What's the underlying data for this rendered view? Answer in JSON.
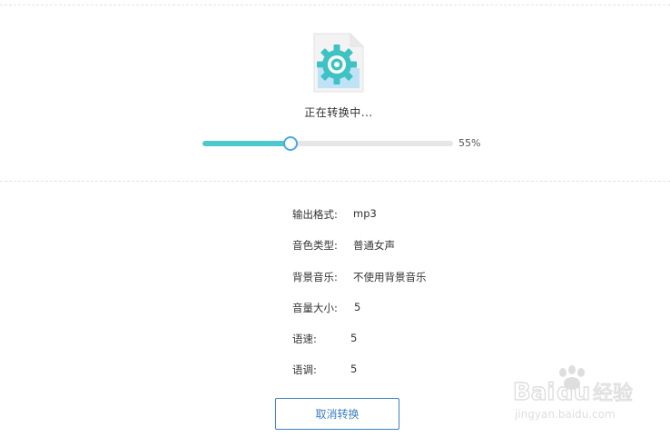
{
  "status": {
    "text": "正在转换中..."
  },
  "progress": {
    "value": 0.55,
    "label": "55%"
  },
  "details": [
    {
      "label": "输出格式:",
      "value": "mp3"
    },
    {
      "label": "音色类型:",
      "value": "普通女声"
    },
    {
      "label": "背景音乐:",
      "value": "不使用背景音乐"
    },
    {
      "label": "音量大小:",
      "value": "5"
    },
    {
      "label": "语速:",
      "value": "5"
    },
    {
      "label": "语调:",
      "value": "5"
    }
  ],
  "cancel_button": {
    "label": "取消转换"
  },
  "watermark": {
    "brand": "Baidu经验",
    "url": "jingyan.baidu.com"
  },
  "colors": {
    "accent_teal": "#4ec8cf",
    "knob_blue": "#4aa9e5",
    "button_blue": "#3b7fc4"
  },
  "icons": {
    "file": "gear-file-icon"
  }
}
